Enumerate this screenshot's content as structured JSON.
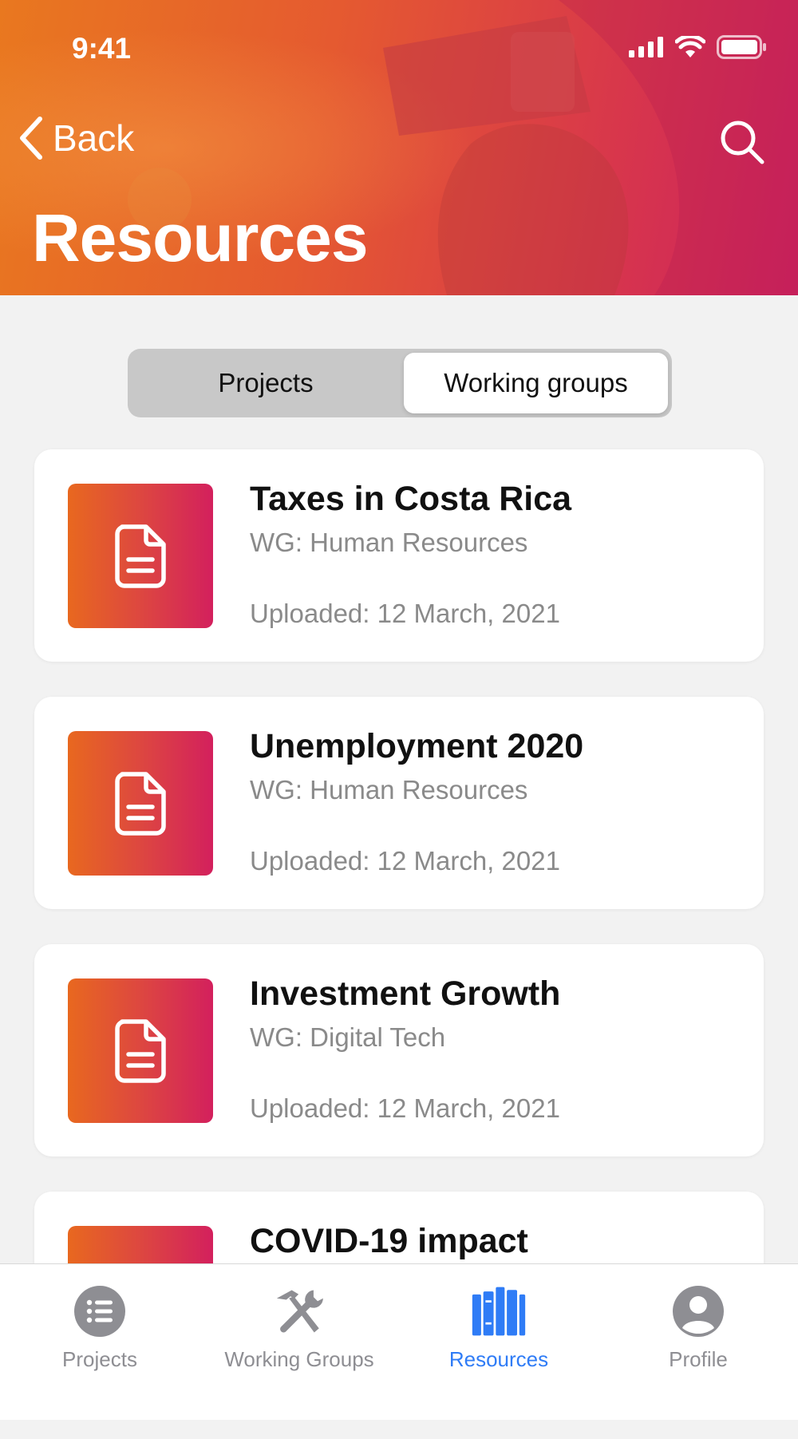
{
  "status_bar": {
    "time": "9:41"
  },
  "header": {
    "back_label": "Back",
    "title": "Resources"
  },
  "segmented": {
    "options": [
      "Projects",
      "Working groups"
    ],
    "selected": "Working groups"
  },
  "resources": [
    {
      "title": "Taxes in Costa Rica",
      "group": "WG: Human Resources",
      "uploaded": "Uploaded: 12 March, 2021"
    },
    {
      "title": "Unemployment 2020",
      "group": "WG: Human Resources",
      "uploaded": "Uploaded: 12 March, 2021"
    },
    {
      "title": "Investment Growth",
      "group": "WG: Digital Tech",
      "uploaded": "Uploaded: 12 March, 2021"
    },
    {
      "title": "COVID-19 impact",
      "group": "",
      "uploaded": ""
    }
  ],
  "tabbar": {
    "tabs": [
      {
        "label": "Projects",
        "icon": "list-icon"
      },
      {
        "label": "Working Groups",
        "icon": "tools-icon"
      },
      {
        "label": "Resources",
        "icon": "books-icon"
      },
      {
        "label": "Profile",
        "icon": "person-icon"
      }
    ],
    "active": "Resources"
  },
  "colors": {
    "header_gradient_start": "#e9781f",
    "header_gradient_end": "#cc2160",
    "accent": "#2f7cf6",
    "inactive_tab": "#8e8e93"
  }
}
